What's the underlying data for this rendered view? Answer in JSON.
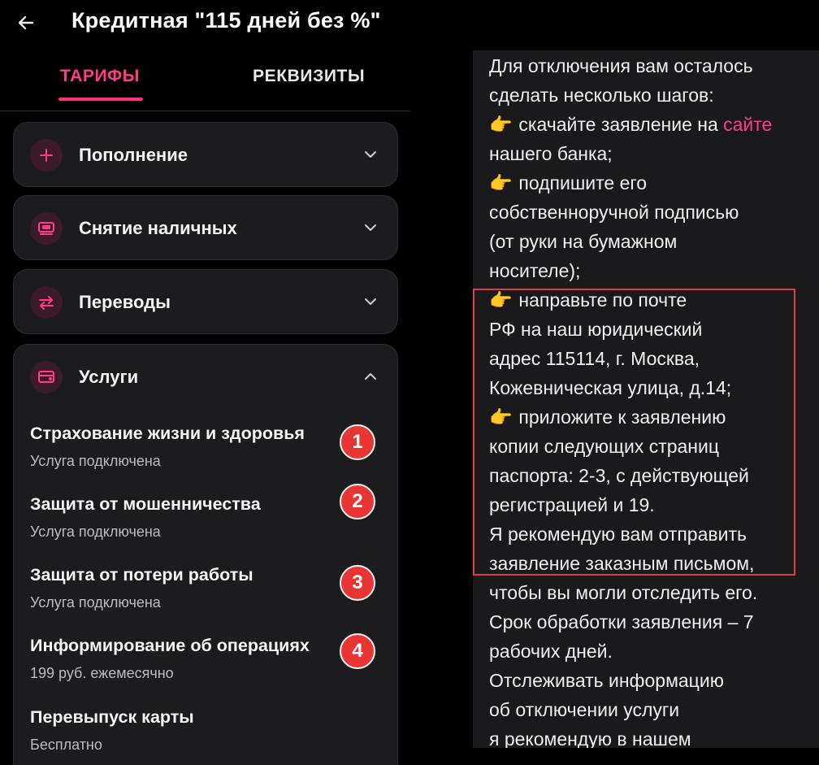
{
  "header": {
    "title": "Кредитная \"115 дней без %\""
  },
  "tabs": {
    "tariffs": "ТАРИФЫ",
    "requisites": "РЕКВИЗИТЫ"
  },
  "sections": [
    {
      "title": "Пополнение",
      "icon": "plus-icon"
    },
    {
      "title": "Снятие наличных",
      "icon": "cash-withdrawal-icon"
    },
    {
      "title": "Переводы",
      "icon": "transfer-arrows-icon"
    },
    {
      "title": "Услуги",
      "icon": "services-card-icon"
    }
  ],
  "services": [
    {
      "title": "Страхование жизни и здоровья",
      "sub": "Услуга подключена",
      "badge": "1"
    },
    {
      "title": "Защита от мошенничества",
      "sub": "Услуга подключена",
      "badge": "2"
    },
    {
      "title": "Защита от потери работы",
      "sub": "Услуга подключена",
      "badge": "3"
    },
    {
      "title": "Информирование об операциях",
      "sub": "199 руб. ежемесячно",
      "badge": "4"
    },
    {
      "title": "Перевыпуск карты",
      "sub": "Бесплатно",
      "badge": ""
    }
  ],
  "message": {
    "l01": "Для отключения вам осталось",
    "l02": "сделать несколько шагов:",
    "l03_emoji": "👉",
    "l03a": " скачайте заявление на ",
    "l03_link": "сайте",
    "l04": "нашего банка;",
    "l05_emoji": "👉",
    "l05": " подпишите его",
    "l06": "собственноручной подписью",
    "l07": "(от руки на бумажном",
    "l08": "носителе);",
    "l09_emoji": "👉",
    "l09": " направьте по почте",
    "l10": "РФ на наш юридический",
    "l11": "адрес 115114, г. Москва,",
    "l12": "Кожевническая улица, д.14;",
    "l13_emoji": "👉",
    "l13": " приложите к заявлению",
    "l14": "копии следующих страниц",
    "l15": "паспорта: 2-3, с действующей",
    "l16": "регистрацией и 19.",
    "l17": "Я рекомендую вам отправить",
    "l18": "заявление заказным письмом,",
    "l19": "чтобы вы могли отследить его.",
    "l20": "Срок обработки заявления – 7",
    "l21": "рабочих дней.",
    "l22": "Отслеживать информацию",
    "l23": "об отключении услуги",
    "l24": "я рекомендую в нашем"
  },
  "colors": {
    "accent": "#ff3b8a",
    "badge": "#e93434",
    "highlight": "#d9403f",
    "card": "#1c1c1f"
  }
}
